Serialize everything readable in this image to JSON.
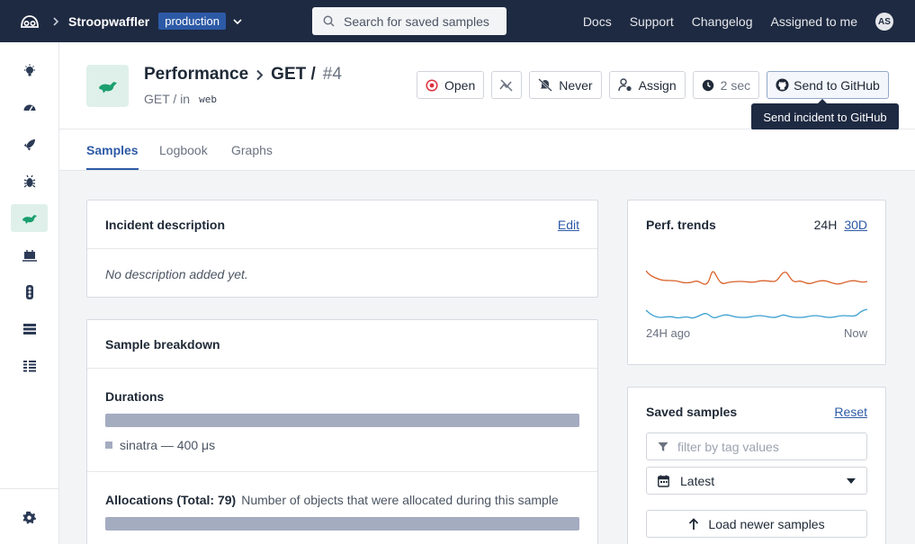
{
  "colors": {
    "topbar": "#1e2a42",
    "accent": "#2d5aa6",
    "namespace_bg": "#dff0ea",
    "namespace_green": "#1b9f6f",
    "trend_orange": "#d9622b",
    "trend_blue": "#3a9fd0",
    "bar_fill": "#a4acc0"
  },
  "topbar": {
    "app_name": "Stroopwaffler",
    "environment": "production",
    "search_placeholder": "Search for saved samples",
    "links": [
      "Docs",
      "Support",
      "Changelog",
      "Assigned to me"
    ],
    "avatar_initials": "AS"
  },
  "sidebar": {
    "items": [
      "lightbulb-icon",
      "dashboard-icon",
      "rocket-icon",
      "bug-icon",
      "performance-icon",
      "host-icon",
      "traffic-light-icon",
      "list-icon",
      "table-icon"
    ],
    "active": "performance-icon",
    "settings": "gear-icon"
  },
  "header": {
    "namespace": "Performance",
    "action": "GET /",
    "number": "#4",
    "subtitle": "GET / in",
    "tag": "web",
    "buttons": {
      "open": "Open",
      "never": "Never",
      "assign": "Assign",
      "interval": "2 sec",
      "github": "Send to GitHub"
    },
    "tooltip": "Send incident to GitHub"
  },
  "tabs": [
    "Samples",
    "Logbook",
    "Graphs"
  ],
  "description_card": {
    "title": "Incident description",
    "edit": "Edit",
    "body": "No description added yet."
  },
  "breakdown_card": {
    "title": "Sample breakdown",
    "durations": {
      "title": "Durations",
      "legend": "sinatra — 400 μs",
      "fraction": 1.0
    },
    "allocations": {
      "title": "Allocations (Total: 79)",
      "note": "Number of objects that were allocated during this sample",
      "fraction": 1.0
    }
  },
  "trends_card": {
    "title": "Perf. trends",
    "range_current": "24H",
    "range_link": "30D",
    "start_label": "24H ago",
    "end_label": "Now"
  },
  "saved_card": {
    "title": "Saved samples",
    "reset": "Reset",
    "filter_placeholder": "filter by tag values",
    "sort_value": "Latest",
    "load_button": "Load newer samples"
  }
}
